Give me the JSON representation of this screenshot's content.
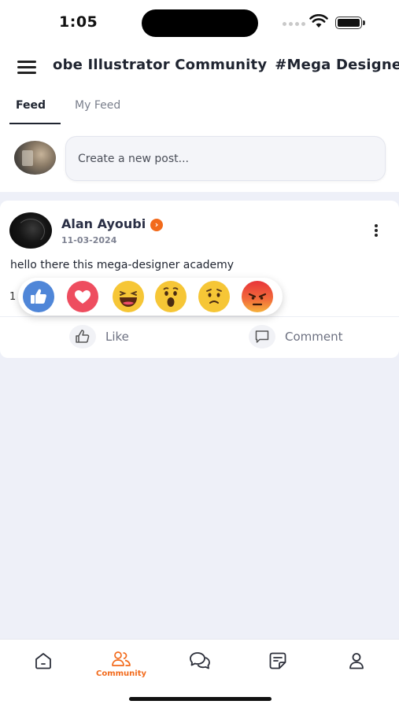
{
  "status_bar": {
    "time": "1:05"
  },
  "header": {
    "title": "obe Illustrator Community",
    "hashtag": "#Mega Designer ."
  },
  "tabs": [
    {
      "label": "Feed",
      "active": true
    },
    {
      "label": "My Feed",
      "active": false
    }
  ],
  "create_post": {
    "placeholder": "Create a new post..."
  },
  "post": {
    "author": "Alan Ayoubi",
    "date": "11-03-2024",
    "text": "hello there this mega-designer academy",
    "reaction_count": "1",
    "actions": {
      "like": "Like",
      "comment": "Comment"
    }
  },
  "reactions": [
    "like",
    "love",
    "haha",
    "wow",
    "sad",
    "angry"
  ],
  "bottom_nav": {
    "items": [
      {
        "icon": "home-icon",
        "label": ""
      },
      {
        "icon": "community-icon",
        "label": "Community",
        "active": true
      },
      {
        "icon": "chat-icon",
        "label": ""
      },
      {
        "icon": "notes-icon",
        "label": ""
      },
      {
        "icon": "profile-icon",
        "label": ""
      }
    ]
  },
  "colors": {
    "accent": "#f26a1b",
    "background": "#eef0f8"
  }
}
